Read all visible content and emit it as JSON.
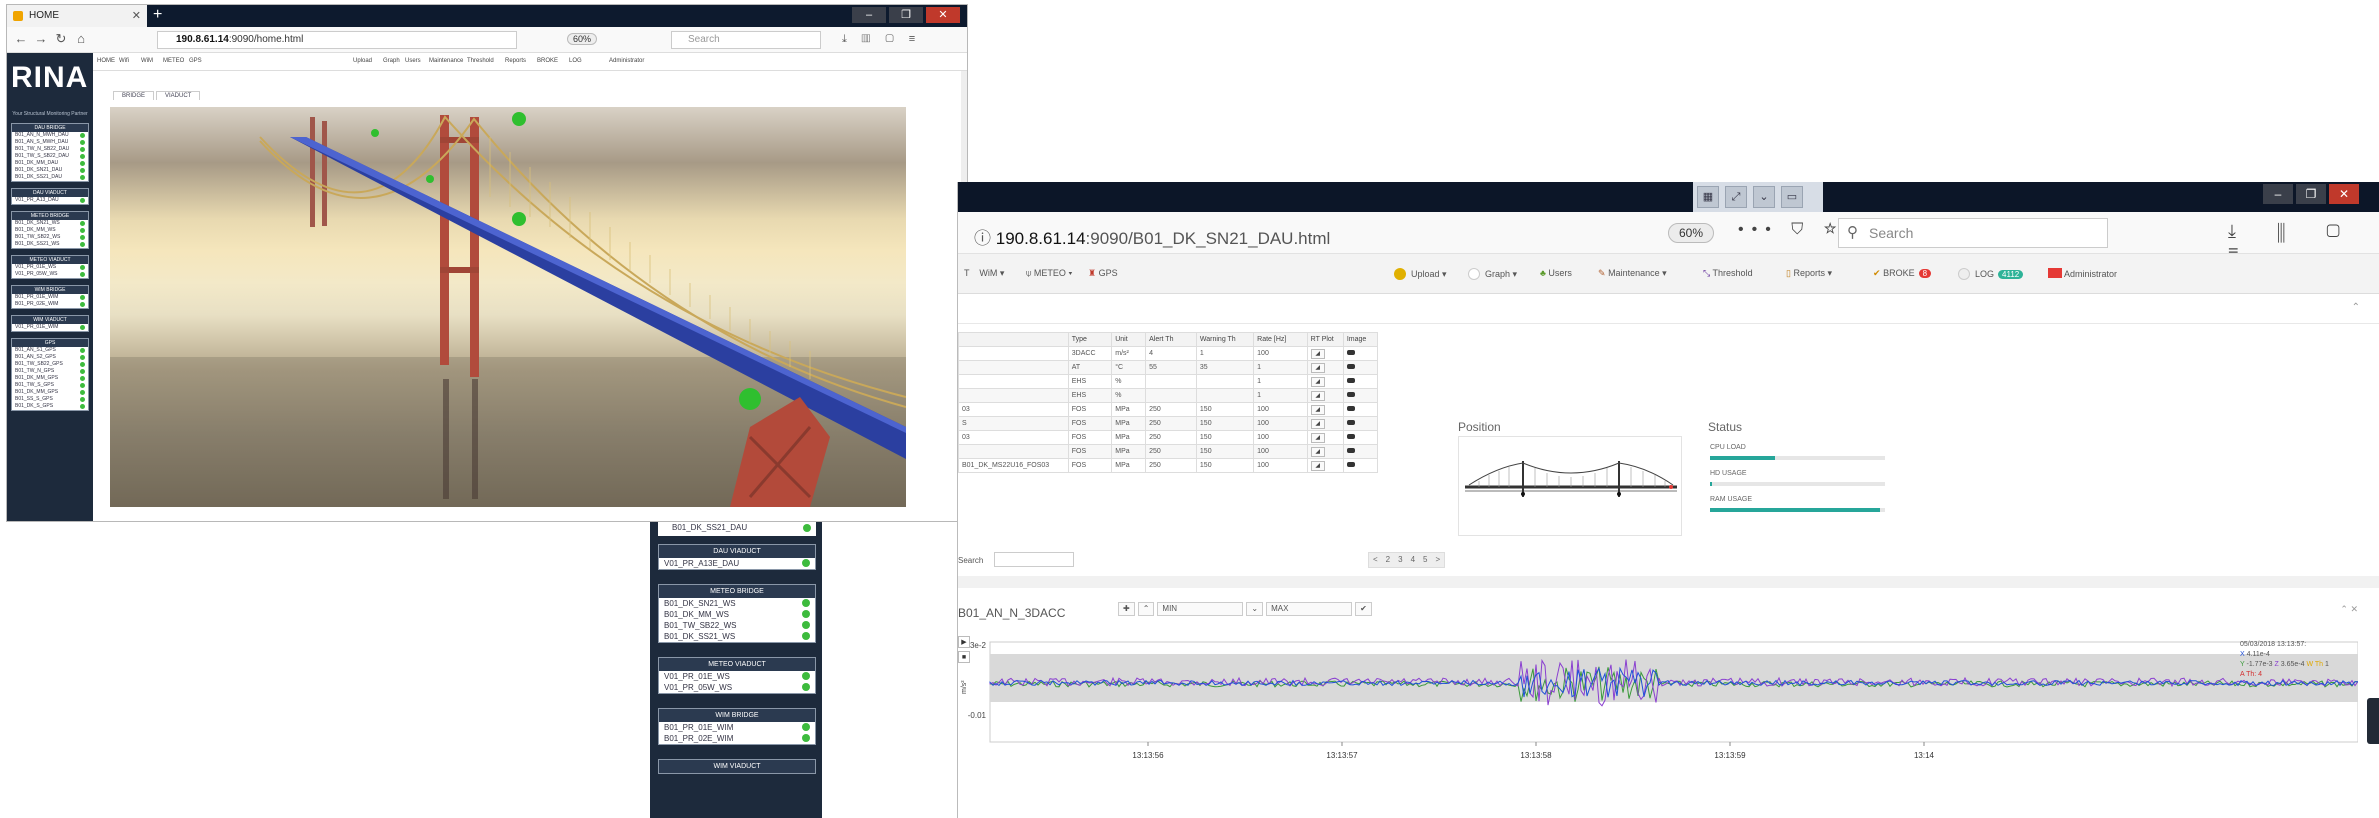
{
  "window_back": {
    "tab_title": "HOME",
    "url_host": "190.8.61.14",
    "url_path": ":9090/home.html",
    "zoom": "60%",
    "search_placeholder": "Search",
    "logo": "RINA",
    "logo_sub": "Your Structural Monitoring Partner",
    "top_menu": [
      "HOME",
      "Wifi",
      "WiM",
      "METEO",
      "GPS",
      "Upload",
      "Graph",
      "Users",
      "Maintenance",
      "Threshold",
      "Reports",
      "BROKE",
      "LOG",
      "Administrator"
    ],
    "top_menu_badges": {
      "broke": "8",
      "log": "4112"
    },
    "subtabs": [
      "BRIDGE",
      "VIADUCT"
    ],
    "sidebar_groups": [
      {
        "title": "DAU BRIDGE",
        "items": [
          "B01_AN_N_MWH_DAU",
          "B01_AN_S_MWH_DAU",
          "B01_TW_N_SB22_DAU",
          "B01_TW_S_SB22_DAU",
          "B01_DK_MM_DAU",
          "B01_DK_SN21_DAU",
          "B01_DK_SS21_DAU"
        ]
      },
      {
        "title": "DAU VIADUCT",
        "items": [
          "V01_PR_A13_DAU"
        ]
      },
      {
        "title": "METEO BRIDGE",
        "items": [
          "B01_DK_SN21_WS",
          "B01_DK_MM_WS",
          "B01_TW_SB22_WS",
          "B01_DK_SS21_WS"
        ]
      },
      {
        "title": "METEO VIADUCT",
        "items": [
          "V01_PR_01E_WS",
          "V01_PR_05W_WS"
        ]
      },
      {
        "title": "WIM BRIDGE",
        "items": [
          "B01_PR_01E_WIM",
          "B01_PR_02E_WIM"
        ]
      },
      {
        "title": "WIM VIADUCT",
        "items": [
          "V01_PR_01E_WIM"
        ]
      },
      {
        "title": "GPS",
        "items": [
          "B01_AN_S1_GPS",
          "B01_AN_S2_GPS",
          "B01_TW_SB22_GPS",
          "B01_TW_N_GPS",
          "B01_DK_MM_GPS",
          "B01_TW_S_GPS",
          "B01_DK_MM_GPS",
          "B01_SS_S_GPS",
          "B01_DK_S_GPS"
        ]
      }
    ]
  },
  "sidebar_front": {
    "fragment_label": "B01_DK_SS21_DAU",
    "groups": [
      {
        "title": "DAU VIADUCT",
        "items": [
          "V01_PR_A13E_DAU"
        ]
      },
      {
        "title": "METEO BRIDGE",
        "items": [
          "B01_DK_SN21_WS",
          "B01_DK_MM_WS",
          "B01_TW_SB22_WS",
          "B01_DK_SS21_WS"
        ]
      },
      {
        "title": "METEO VIADUCT",
        "items": [
          "V01_PR_01E_WS",
          "V01_PR_05W_WS"
        ]
      },
      {
        "title": "WIM BRIDGE",
        "items": [
          "B01_PR_01E_WIM",
          "B01_PR_02E_WIM"
        ]
      },
      {
        "title": "WIM VIADUCT",
        "items": []
      }
    ]
  },
  "window_front": {
    "url_host": "190.8.61.14",
    "url_path": ":9090/B01_DK_SN21_DAU.html",
    "zoom": "60%",
    "search_placeholder": "Search",
    "menu": {
      "wim": "WiM",
      "meteo": "METEO",
      "gps": "GPS",
      "upload": "Upload",
      "graph": "Graph",
      "users": "Users",
      "maintenance": "Maintenance",
      "threshold": "Threshold",
      "reports": "Reports",
      "broke": "BROKE",
      "broke_count": "8",
      "log": "LOG",
      "log_count": "4112",
      "admin": "Administrator"
    },
    "table": {
      "headers": [
        "",
        "Type",
        "Unit",
        "Alert Th",
        "Warning Th",
        "Rate [Hz]",
        "RT Plot",
        "Image"
      ],
      "rows": [
        [
          "",
          "3DACC",
          "m/s²",
          "4",
          "1",
          "100"
        ],
        [
          "",
          "AT",
          "°C",
          "55",
          "35",
          "1"
        ],
        [
          "",
          "EHS",
          "%",
          "",
          "",
          "1"
        ],
        [
          "",
          "EHS",
          "%",
          "",
          "",
          "1"
        ],
        [
          "03",
          "FOS",
          "MPa",
          "250",
          "150",
          "100"
        ],
        [
          "S",
          "FOS",
          "MPa",
          "250",
          "150",
          "100"
        ],
        [
          "03",
          "FOS",
          "MPa",
          "250",
          "150",
          "100"
        ],
        [
          "",
          "FOS",
          "MPa",
          "250",
          "150",
          "100"
        ],
        [
          "B01_DK_MS22U16_FOS03",
          "FOS",
          "MPa",
          "250",
          "150",
          "100"
        ]
      ],
      "search_label": "Search",
      "pager": [
        "<",
        "2",
        "3",
        "4",
        "5",
        ">"
      ]
    },
    "position_title": "Position",
    "status_title": "Status",
    "status": [
      {
        "label": "CPU LOAD",
        "value": 0.37
      },
      {
        "label": "HD USAGE",
        "value": 0.01
      },
      {
        "label": "RAM USAGE",
        "value": 0.97
      }
    ],
    "chart": {
      "title": "B01_AN_N_3DACC",
      "min_label": "MIN",
      "max_label": "MAX",
      "y_tick_top": "3e-2",
      "y_tick_bottom": "-0.01",
      "y_unit": "m/s²",
      "x_ticks": [
        "13:13:56",
        "13:13:57",
        "13:13:58",
        "13:13:59",
        "13:14"
      ],
      "legend_time": "05/03/2018 13:13:57:",
      "legend_x_label": "X",
      "legend_x_value": "4.11e-4",
      "legend_y_label": "Y",
      "legend_y_value": "-1.77e-3",
      "legend_z_label": "Z",
      "legend_z_value": "3.65e-4",
      "legend_wth_label": "W Th",
      "legend_wth_value": "1",
      "legend_ath_label": "A Th",
      "legend_ath_value": "4",
      "colors": {
        "x": "#1f4fd8",
        "y": "#3a9a3a",
        "z": "#8a3fd0",
        "warn": "#e0a800",
        "alert": "#d32f2f"
      }
    }
  }
}
